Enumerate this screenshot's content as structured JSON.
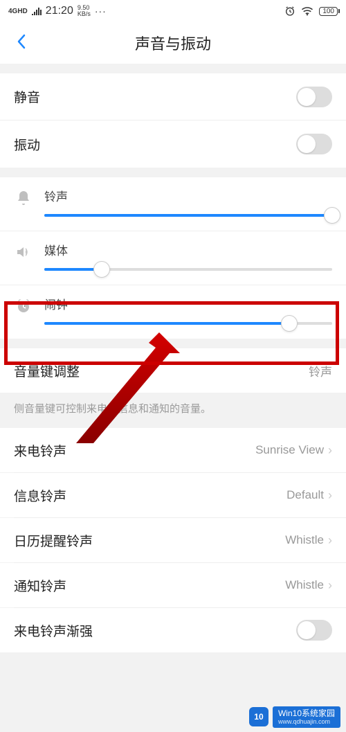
{
  "status": {
    "network": "4GHD",
    "time": "21:20",
    "speed_top": "9.50",
    "speed_bottom": "KB/s",
    "more": "···",
    "battery": "100"
  },
  "header": {
    "title": "声音与振动"
  },
  "toggles": {
    "mute": {
      "label": "静音"
    },
    "vibrate": {
      "label": "振动"
    }
  },
  "sliders": {
    "ring": {
      "label": "铃声",
      "percent": 100
    },
    "media": {
      "label": "媒体",
      "percent": 20
    },
    "alarm": {
      "label": "闹钟",
      "percent": 85
    }
  },
  "volume_key": {
    "label": "音量键调整",
    "value": "铃声",
    "desc": "侧音量键可控制来电、信息和通知的音量。"
  },
  "ringtones": {
    "incoming": {
      "label": "来电铃声",
      "value": "Sunrise View"
    },
    "message": {
      "label": "信息铃声",
      "value": "Default"
    },
    "calendar": {
      "label": "日历提醒铃声",
      "value": "Whistle"
    },
    "notification": {
      "label": "通知铃声",
      "value": "Whistle"
    },
    "crescendo": {
      "label": "来电铃声渐强"
    }
  },
  "watermark": {
    "badge": "10",
    "line1": "Win10系统家园",
    "line2": "www.qdhuajin.com"
  }
}
